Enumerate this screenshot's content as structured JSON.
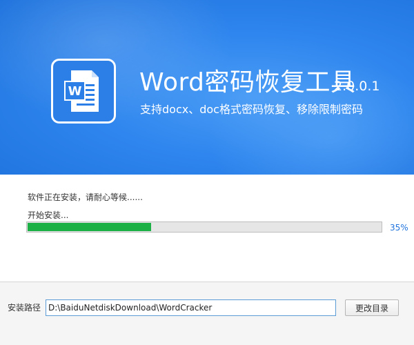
{
  "banner": {
    "title": "Word密码恢复工具",
    "version": "2.0.0.1",
    "subtitle": "支持docx、doc格式密码恢复、移除限制密码",
    "icon": "word-document-icon",
    "icon_letter": "W"
  },
  "progress": {
    "status_text": "软件正在安装，请耐心等候......",
    "sub_status": "开始安装...",
    "value": 0.35,
    "percent_label": "35%",
    "fill_color": "#1db046"
  },
  "install": {
    "path_label": "安装路径",
    "path_value": "D:\\BaiduNetdiskDownload\\WordCracker",
    "change_button_label": "更改目录"
  },
  "colors": {
    "accent": "#2f86ee",
    "percent_text": "#1f73dd"
  }
}
